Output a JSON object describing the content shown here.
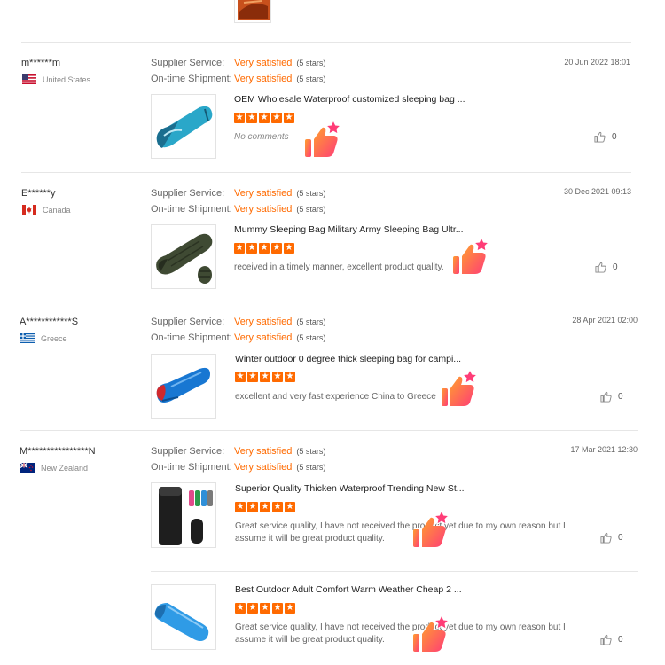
{
  "reviews": [
    {
      "user": "m******m",
      "country": "United States",
      "supplier_label": "Supplier Service:",
      "supplier_value": "Very satisfied",
      "supplier_stars": "(5 stars)",
      "shipment_label": "On-time Shipment:",
      "shipment_value": "Very satisfied",
      "shipment_stars": "(5 stars)",
      "date": "20 Jun 2022 18:01",
      "products": [
        {
          "name": "OEM Wholesale Waterproof customized sleeping bag ...",
          "comment": "No comments",
          "likes": "0"
        }
      ]
    },
    {
      "user": "E******y",
      "country": "Canada",
      "supplier_label": "Supplier Service:",
      "supplier_value": "Very satisfied",
      "supplier_stars": "(5 stars)",
      "shipment_label": "On-time Shipment:",
      "shipment_value": "Very satisfied",
      "shipment_stars": "(5 stars)",
      "date": "30 Dec 2021 09:13",
      "products": [
        {
          "name": "Mummy Sleeping Bag Military Army Sleeping Bag Ultr...",
          "comment": "received in a timely manner, excellent product quality.",
          "likes": "0"
        }
      ]
    },
    {
      "user": "A************S",
      "country": "Greece",
      "supplier_label": "Supplier Service:",
      "supplier_value": "Very satisfied",
      "supplier_stars": "(5 stars)",
      "shipment_label": "On-time Shipment:",
      "shipment_value": "Very satisfied",
      "shipment_stars": "(5 stars)",
      "date": "28 Apr 2021 02:00",
      "products": [
        {
          "name": "Winter outdoor 0 degree thick sleeping bag for campi...",
          "comment": "excellent and very fast experience China to Greece",
          "likes": "0"
        }
      ]
    },
    {
      "user": "M****************N",
      "country": "New Zealand",
      "supplier_label": "Supplier Service:",
      "supplier_value": "Very satisfied",
      "supplier_stars": "(5 stars)",
      "shipment_label": "On-time Shipment:",
      "shipment_value": "Very satisfied",
      "shipment_stars": "(5 stars)",
      "date": "17 Mar 2021 12:30",
      "products": [
        {
          "name": "Superior Quality Thicken Waterproof Trending New St...",
          "comment": "Great service quality, I have not received the product yet due to my own reason but I assume it will be great product quality.",
          "likes": "0"
        },
        {
          "name": "Best Outdoor Adult Comfort Warm Weather Cheap 2 ...",
          "comment": "Great service quality, I have not received the product yet due to my own reason but I assume it will be great product quality.",
          "likes": "0"
        }
      ]
    }
  ],
  "colors": {
    "accent": "#ff6a00",
    "badge_start": "#ff9f2e",
    "badge_end": "#ff3d77"
  },
  "icons": {
    "like": "thumbs-up-outline-icon",
    "badge": "thumbs-up-badge-icon",
    "star": "star-icon"
  }
}
